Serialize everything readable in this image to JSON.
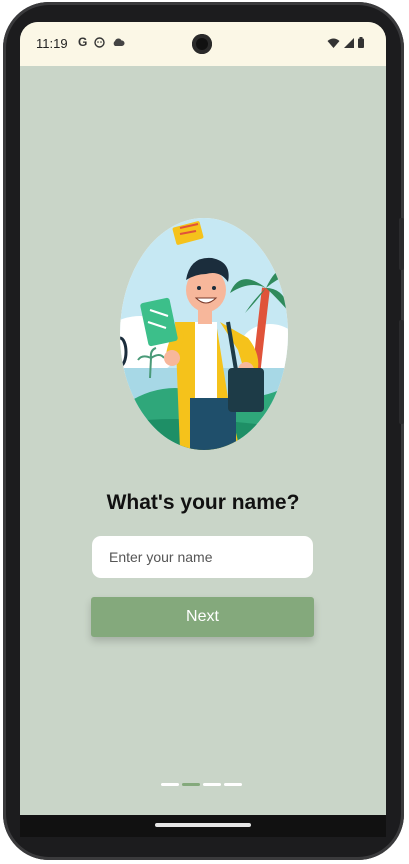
{
  "status_bar": {
    "time": "11:19",
    "left_icons": [
      "google-icon",
      "face-icon",
      "cloud-icon"
    ],
    "right_icons": [
      "wifi-icon",
      "signal-icon",
      "battery-icon"
    ]
  },
  "onboarding": {
    "title": "What's your name?",
    "name_input": {
      "placeholder": "Enter your name",
      "value": ""
    },
    "next_label": "Next",
    "pager": {
      "total": 4,
      "active_index": 1
    }
  },
  "colors": {
    "background": "#c9d5c8",
    "status_bar": "#fbf7e6",
    "accent": "#84a97c",
    "button_text": "#ffffff"
  }
}
